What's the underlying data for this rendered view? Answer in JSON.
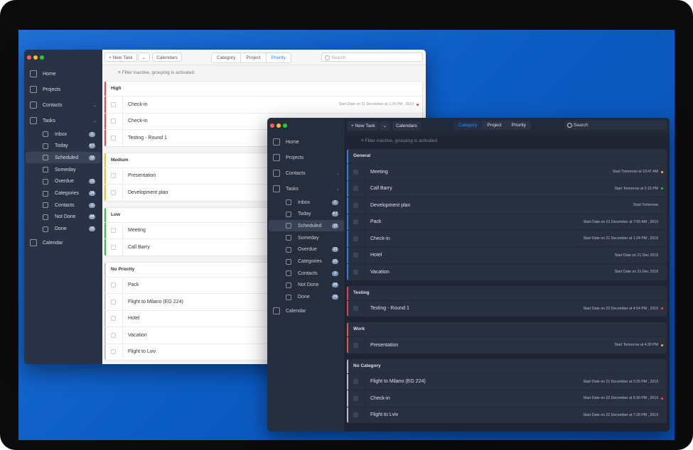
{
  "light": {
    "toolbar": {
      "new_task": "New Task",
      "calendars": "Calendars",
      "groupings": [
        "Category",
        "Project",
        "Priority"
      ],
      "active_grouping": "Priority",
      "search_placeholder": "Search"
    },
    "filter_text": "Filter inactive, grouping is activated",
    "sidebar": {
      "items": [
        {
          "label": "Home",
          "icon": "home-icon"
        },
        {
          "label": "Projects",
          "icon": "projects-icon"
        },
        {
          "label": "Contacts",
          "icon": "contacts-icon",
          "chevron": true
        },
        {
          "label": "Tasks",
          "icon": "tasks-icon",
          "chevron": true
        }
      ],
      "sub_items": [
        {
          "label": "Inbox",
          "icon": "inbox-icon",
          "badge": "2"
        },
        {
          "label": "Today",
          "icon": "today-icon",
          "badge": "4 7"
        },
        {
          "label": "Scheduled",
          "icon": "clock-icon",
          "badge": "12",
          "selected": true
        },
        {
          "label": "Someday",
          "icon": "someday-icon"
        },
        {
          "label": "Overdue",
          "icon": "overdue-icon",
          "badge": "13"
        },
        {
          "label": "Categories",
          "icon": "categories-icon",
          "badge": "14"
        },
        {
          "label": "Contacts",
          "icon": "contacts-icon",
          "badge": "3"
        },
        {
          "label": "Not Done",
          "icon": "not-done-icon",
          "badge": "34"
        },
        {
          "label": "Done",
          "icon": "done-icon",
          "badge": "15"
        }
      ],
      "footer": {
        "label": "Calendar",
        "icon": "calendar-icon"
      }
    },
    "groups": [
      {
        "name": "High",
        "color": "#e8474c",
        "tasks": [
          {
            "title": "Check-in",
            "date": "Start Date on 21 December at 1:24 PM , 2019",
            "dot": "#e8474c"
          },
          {
            "title": "Check-in"
          },
          {
            "title": "Testing - Round 1"
          }
        ]
      },
      {
        "name": "Medium",
        "color": "#f2c12e",
        "tasks": [
          {
            "title": "Presentation"
          },
          {
            "title": "Development plan"
          }
        ]
      },
      {
        "name": "Low",
        "color": "#2fc23f",
        "tasks": [
          {
            "title": "Meeting"
          },
          {
            "title": "Call Barry"
          }
        ]
      },
      {
        "name": "No Priority",
        "color": "#c8c8c8",
        "tasks": [
          {
            "title": "Pack"
          },
          {
            "title": "Flight to Milano (EG 224)"
          },
          {
            "title": "Hotel"
          },
          {
            "title": "Vacation"
          },
          {
            "title": "Flight to Lviv"
          }
        ]
      }
    ]
  },
  "dark": {
    "toolbar": {
      "new_task": "New Task",
      "calendars": "Calendars",
      "groupings": [
        "Category",
        "Project",
        "Priority"
      ],
      "active_grouping": "Category",
      "search_placeholder": "Search"
    },
    "filter_text": "Filter inactive, grouping is activated",
    "sidebar": {
      "items": [
        {
          "label": "Home",
          "icon": "home-icon"
        },
        {
          "label": "Projects",
          "icon": "projects-icon"
        },
        {
          "label": "Contacts",
          "icon": "contacts-icon",
          "chevron": true
        },
        {
          "label": "Tasks",
          "icon": "tasks-icon",
          "chevron": true
        }
      ],
      "sub_items": [
        {
          "label": "Inbox",
          "icon": "inbox-icon",
          "badge": "2"
        },
        {
          "label": "Today",
          "icon": "today-icon",
          "badge": "4 7"
        },
        {
          "label": "Scheduled",
          "icon": "clock-icon",
          "badge": "12",
          "selected": true
        },
        {
          "label": "Someday",
          "icon": "someday-icon"
        },
        {
          "label": "Overdue",
          "icon": "overdue-icon",
          "badge": "13"
        },
        {
          "label": "Categories",
          "icon": "categories-icon",
          "badge": "21"
        },
        {
          "label": "Contacts",
          "icon": "contacts-icon",
          "badge": "3"
        },
        {
          "label": "Not Done",
          "icon": "not-done-icon",
          "badge": "34"
        },
        {
          "label": "Done",
          "icon": "done-icon",
          "badge": "24"
        }
      ],
      "footer": {
        "label": "Calendar",
        "icon": "calendar-icon"
      }
    },
    "groups": [
      {
        "name": "General",
        "color": "#2f7fe0",
        "tasks": [
          {
            "title": "Meeting",
            "date": "Start Tomorrow at 10:47 AM",
            "dot": "#f2c12e"
          },
          {
            "title": "Call Barry",
            "date": "Start Tomorrow at 2:15 PM",
            "dot": "#2fc23f"
          },
          {
            "title": "Development plan",
            "date": "Start Tomorrow"
          },
          {
            "title": "Pack",
            "date": "Start Date on 21 December at 7:50 AM , 2019"
          },
          {
            "title": "Check-in",
            "date": "Start Date on 21 December at 1:24 PM , 2019"
          },
          {
            "title": "Hotel",
            "date": "Start Date on 21 Dec 2019"
          },
          {
            "title": "Vacation",
            "date": "Start Date on 21 Dec 2019"
          }
        ]
      },
      {
        "name": "Testing",
        "color": "#d9445a",
        "tasks": [
          {
            "title": "Testing - Round 1",
            "date": "Start Date on 23 December at 4:54 PM , 2019",
            "dot": "#e8474c"
          }
        ]
      },
      {
        "name": "Work",
        "color": "#e05a4a",
        "tasks": [
          {
            "title": "Presentation",
            "date": "Start Tomorrow at 4:30 PM",
            "dot": "#f2c12e"
          }
        ]
      },
      {
        "name": "No Category",
        "color": "#b8bcc4",
        "tasks": [
          {
            "title": "Flight to Milano (EG 224)",
            "date": "Start Date on 21 December at 3:25 PM , 2019"
          },
          {
            "title": "Check-in",
            "date": "Start Date on 22 December at 5:30 PM , 2019",
            "dot": "#e8474c"
          },
          {
            "title": "Flight to Lviv",
            "date": "Start Date on 22 December at 7:28 PM , 2019"
          }
        ]
      }
    ]
  }
}
